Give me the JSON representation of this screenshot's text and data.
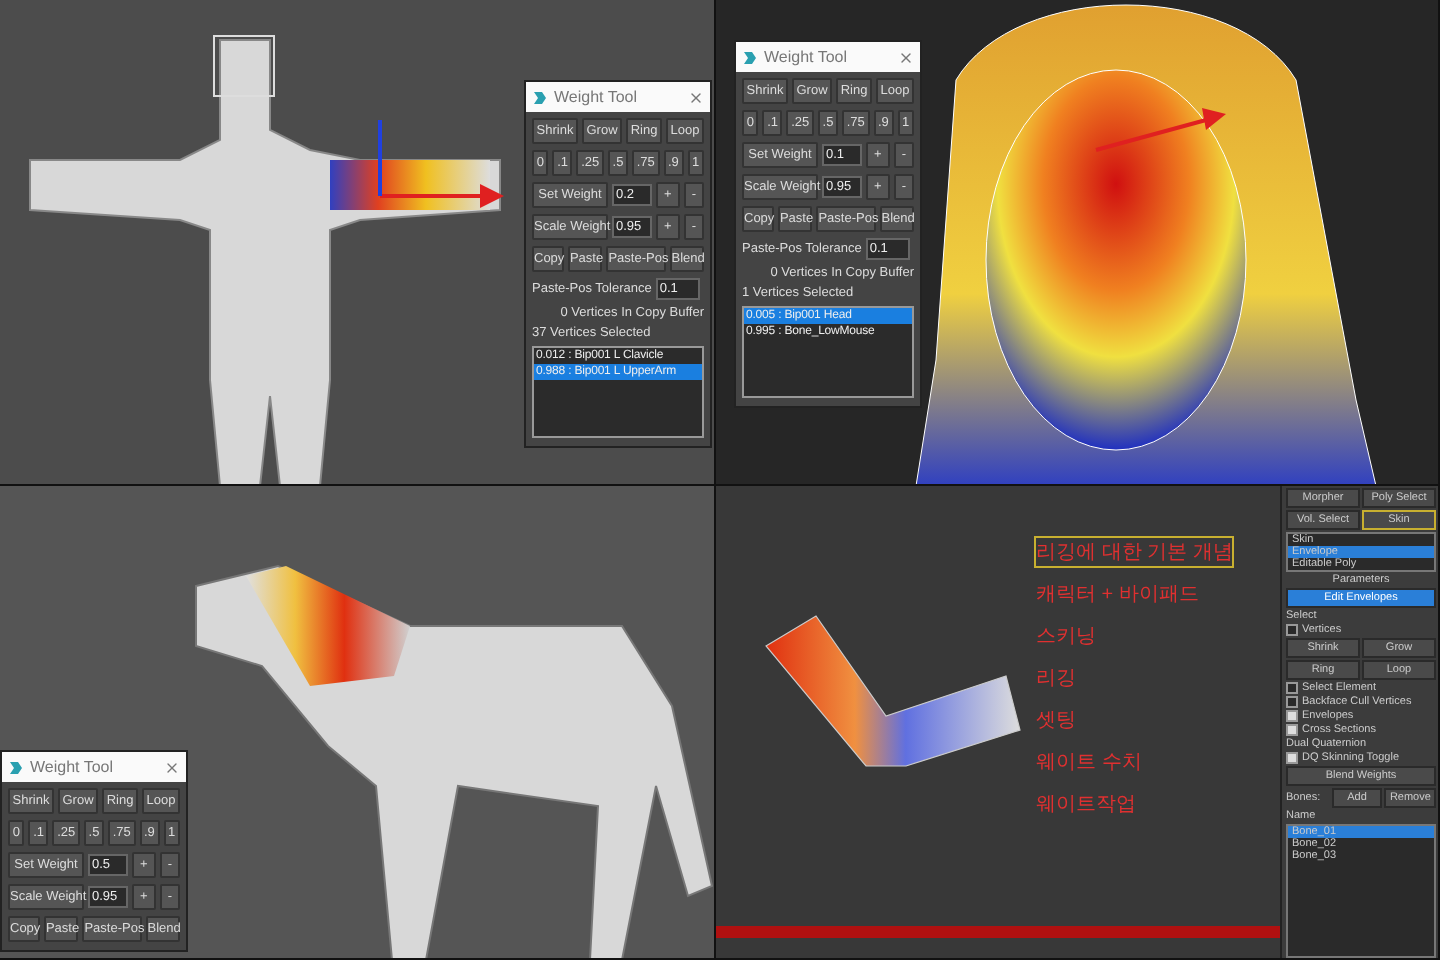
{
  "viewports": [
    {
      "kind": "character",
      "panel": {
        "title": "Weight Tool",
        "ops": [
          "Shrink",
          "Grow",
          "Ring",
          "Loop"
        ],
        "presets": [
          "0",
          ".1",
          ".25",
          ".5",
          ".75",
          ".9",
          "1"
        ],
        "set_weight": {
          "label": "Set Weight",
          "value": "0.2"
        },
        "scale_weight": {
          "label": "Scale Weight",
          "value": "0.95"
        },
        "steps": [
          "+",
          "-"
        ],
        "copy_ops": [
          "Copy",
          "Paste",
          "Paste-Pos",
          "Blend"
        ],
        "tolerance": {
          "label": "Paste-Pos Tolerance",
          "value": "0.1"
        },
        "buffer": "0 Vertices In Copy Buffer",
        "selected_count": "37 Vertices Selected",
        "bones": [
          {
            "label": "0.012 : Bip001 L Clavicle",
            "selected": false
          },
          {
            "label": "0.988 : Bip001 L UpperArm",
            "selected": true
          }
        ]
      }
    },
    {
      "kind": "head",
      "panel": {
        "title": "Weight Tool",
        "ops": [
          "Shrink",
          "Grow",
          "Ring",
          "Loop"
        ],
        "presets": [
          "0",
          ".1",
          ".25",
          ".5",
          ".75",
          ".9",
          "1"
        ],
        "set_weight": {
          "label": "Set Weight",
          "value": "0.1"
        },
        "scale_weight": {
          "label": "Scale Weight",
          "value": "0.95"
        },
        "steps": [
          "+",
          "-"
        ],
        "copy_ops": [
          "Copy",
          "Paste",
          "Paste-Pos",
          "Blend"
        ],
        "tolerance": {
          "label": "Paste-Pos Tolerance",
          "value": "0.1"
        },
        "buffer": "0 Vertices In Copy Buffer",
        "selected_count": "1 Vertices Selected",
        "bones": [
          {
            "label": "0.005 : Bip001 Head",
            "selected": true
          },
          {
            "label": "0.995 : Bone_LowMouse",
            "selected": false
          }
        ]
      }
    },
    {
      "kind": "horse",
      "panel": {
        "title": "Weight Tool",
        "ops": [
          "Shrink",
          "Grow",
          "Ring",
          "Loop"
        ],
        "presets": [
          "0",
          ".1",
          ".25",
          ".5",
          ".75",
          ".9",
          "1"
        ],
        "set_weight": {
          "label": "Set Weight",
          "value": "0.5"
        },
        "scale_weight": {
          "label": "Scale Weight",
          "value": "0.95"
        },
        "steps": [
          "+",
          "-"
        ],
        "copy_ops": [
          "Copy",
          "Paste",
          "Paste-Pos",
          "Blend"
        ]
      }
    },
    {
      "kind": "limb",
      "notes": [
        {
          "text": "리깅에 대한 기본 개념",
          "highlighted": true
        },
        {
          "text": "캐릭터 + 바이패드",
          "highlighted": false
        },
        {
          "text": "스키닝",
          "highlighted": false
        },
        {
          "text": "리깅",
          "highlighted": false
        },
        {
          "text": "셋팅",
          "highlighted": false
        },
        {
          "text": "웨이트 수치",
          "highlighted": false
        },
        {
          "text": "웨이트작업",
          "highlighted": false
        }
      ],
      "command_panel": {
        "modifier_buttons": [
          {
            "label": "Morpher",
            "highlighted": false
          },
          {
            "label": "Poly Select",
            "highlighted": false
          },
          {
            "label": "Vol. Select",
            "highlighted": false
          },
          {
            "label": "Skin",
            "highlighted": true
          }
        ],
        "stack": [
          {
            "label": "Skin",
            "selected": false
          },
          {
            "label": "Envelope",
            "selected": true
          },
          {
            "label": "Editable Poly",
            "selected": false
          }
        ],
        "rollout": "Parameters",
        "edit_button": "Edit Envelopes",
        "select_label": "Select",
        "options_top": [
          {
            "label": "Vertices",
            "checked": false
          }
        ],
        "vertex_ops": [
          "Shrink",
          "Grow",
          "Ring",
          "Loop"
        ],
        "options": [
          {
            "label": "Select Element",
            "checked": false
          },
          {
            "label": "Backface Cull Vertices",
            "checked": false
          },
          {
            "label": "Envelopes",
            "checked": true
          },
          {
            "label": "Cross Sections",
            "checked": true
          }
        ],
        "dq_label": "Dual Quaternion",
        "dq_option": {
          "label": "DQ Skinning Toggle",
          "checked": true
        },
        "blend_button": "Blend Weights",
        "bones_label": "Bones:",
        "bone_ops": [
          "Add",
          "Remove"
        ],
        "name_header": "Name",
        "bones": [
          {
            "label": "Bone_01",
            "selected": true
          },
          {
            "label": "Bone_02",
            "selected": false
          },
          {
            "label": "Bone_03",
            "selected": false
          }
        ]
      }
    }
  ]
}
